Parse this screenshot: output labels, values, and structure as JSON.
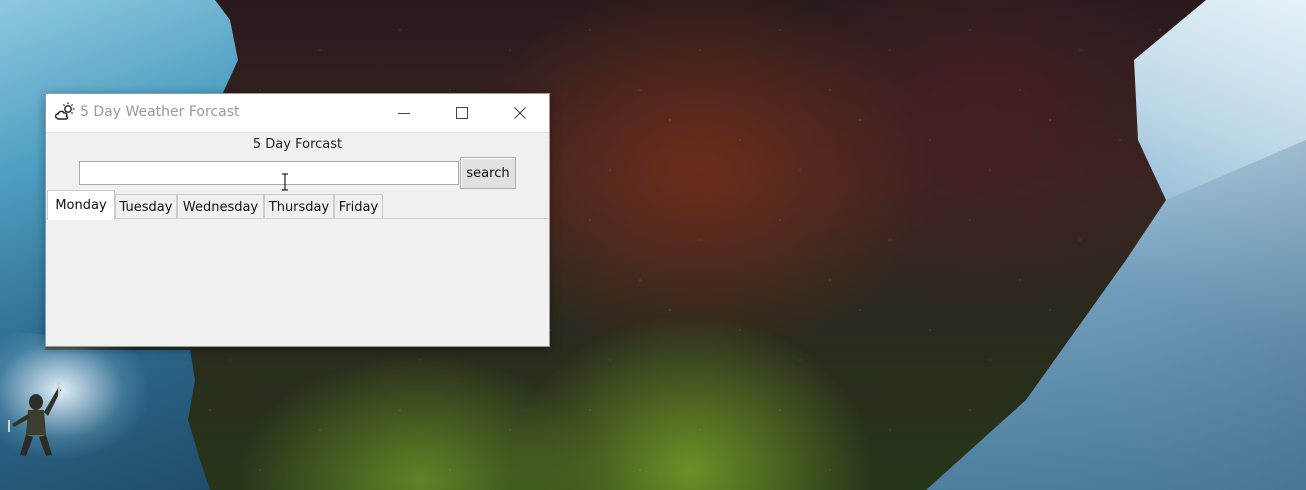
{
  "window": {
    "title": "5 Day Weather Forcast",
    "icon": "weather-partly-cloudy-icon",
    "controls": [
      "minimize-icon",
      "maximize-icon",
      "close-icon"
    ]
  },
  "main": {
    "heading": "5 Day Forcast",
    "search": {
      "value": "",
      "placeholder": "",
      "button_label": "search"
    },
    "tabs": [
      {
        "label": "Monday",
        "active": true
      },
      {
        "label": "Tuesday",
        "active": false
      },
      {
        "label": "Wednesday",
        "active": false
      },
      {
        "label": "Thursday",
        "active": false
      },
      {
        "label": "Friday",
        "active": false
      }
    ]
  },
  "colors": {
    "window_bg": "#f0f0f0",
    "titlebar_bg": "#ffffff",
    "title_text": "#999999"
  }
}
